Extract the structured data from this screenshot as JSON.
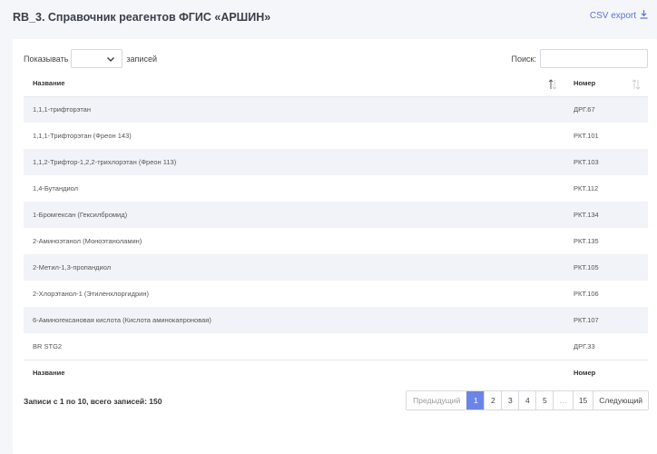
{
  "page": {
    "title": "RB_3. Справочник реагентов ФГИС «АРШИН»",
    "csv_export": "CSV export"
  },
  "controls": {
    "show_label": "Показывать",
    "entries_label": "записей",
    "search_label": "Поиск:"
  },
  "table": {
    "columns": [
      "Название",
      "Номер"
    ],
    "rows": [
      {
        "name": "1,1,1-трифторэтан",
        "number": "ДРГ.67"
      },
      {
        "name": "1,1,1-Трифторэтан (Фреон 143)",
        "number": "РКТ.101"
      },
      {
        "name": "1,1,2-Трифтор-1,2,2-трихлорэтан (Фреон 113)",
        "number": "РКТ.103"
      },
      {
        "name": "1,4-Бутандиол",
        "number": "РКТ.112"
      },
      {
        "name": "1-Бромгексан (Гексилбромид)",
        "number": "РКТ.134"
      },
      {
        "name": "2-Аминоэтанол (Моноэтаноламин)",
        "number": "РКТ.135"
      },
      {
        "name": "2-Метил-1,3-пропандиол",
        "number": "РКТ.105"
      },
      {
        "name": "2-Хлорэтанол-1 (Этиленхлоргидрин)",
        "number": "РКТ.106"
      },
      {
        "name": "6-Аминогексановая кислота (Кислота аминокапроновая)",
        "number": "РКТ.107"
      },
      {
        "name": "BR STG2",
        "number": "ДРГ.33"
      }
    ]
  },
  "footer": {
    "info": "Записи с 1 по 10, всего записей: 150",
    "prev": "Предыдущий",
    "pages": [
      "1",
      "2",
      "3",
      "4",
      "5",
      "…",
      "15"
    ],
    "next": "Следующий",
    "active_page": "1"
  },
  "colors": {
    "accent": "#6b84e6",
    "link": "#5a74d8",
    "row_stripe": "#f2f3f8"
  }
}
